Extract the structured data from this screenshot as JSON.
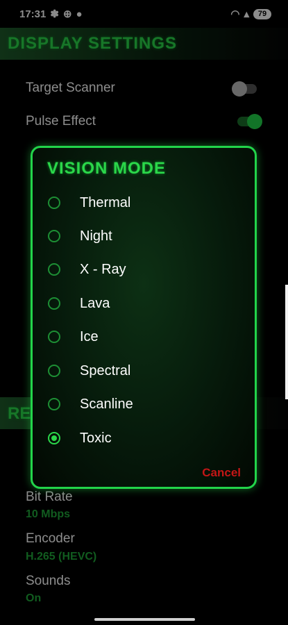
{
  "status_bar": {
    "time": "17:31",
    "battery": "79"
  },
  "display_settings": {
    "title": "DISPLAY SETTINGS",
    "target_scanner": {
      "label": "Target Scanner",
      "enabled": false
    },
    "pulse_effect": {
      "label": "Pulse Effect",
      "enabled": true
    }
  },
  "recording": {
    "bit_rate": {
      "label": "Bit Rate",
      "value": "10 Mbps"
    },
    "encoder": {
      "label": "Encoder",
      "value": "H.265 (HEVC)"
    },
    "sounds": {
      "label": "Sounds",
      "value": "On"
    }
  },
  "dialog": {
    "title": "VISION MODE",
    "options": [
      "Thermal",
      "Night",
      "X - Ray",
      "Lava",
      "Ice",
      "Spectral",
      "Scanline",
      "Toxic"
    ],
    "selected": "Toxic",
    "cancel_label": "Cancel"
  },
  "colors": {
    "accent": "#2bd74a",
    "cancel": "#c41616",
    "value_green": "#1fa83a"
  }
}
